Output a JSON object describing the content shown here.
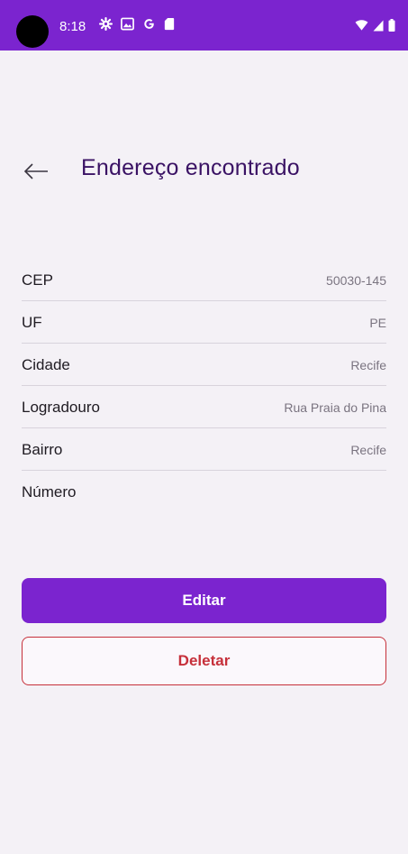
{
  "status_bar": {
    "time": "8:18",
    "left_icons": [
      "gear-icon",
      "gallery-icon",
      "google-icon",
      "sd-card-icon"
    ],
    "right_icons": [
      "wifi-icon",
      "signal-icon",
      "battery-icon"
    ],
    "background_color": "#7b24cf"
  },
  "header": {
    "title": "Endereço encontrado",
    "back_icon": "arrow-left-icon"
  },
  "address": {
    "rows": [
      {
        "label": "CEP",
        "value": "50030-145"
      },
      {
        "label": "UF",
        "value": "PE"
      },
      {
        "label": "Cidade",
        "value": "Recife"
      },
      {
        "label": "Logradouro",
        "value": "Rua Praia do Pina"
      },
      {
        "label": "Bairro",
        "value": "Recife"
      },
      {
        "label": "Número",
        "value": ""
      }
    ]
  },
  "actions": {
    "edit_label": "Editar",
    "delete_label": "Deletar"
  },
  "colors": {
    "primary": "#7b24cf",
    "title": "#3a1264",
    "danger": "#c6303a",
    "background": "#f4f1f6"
  }
}
